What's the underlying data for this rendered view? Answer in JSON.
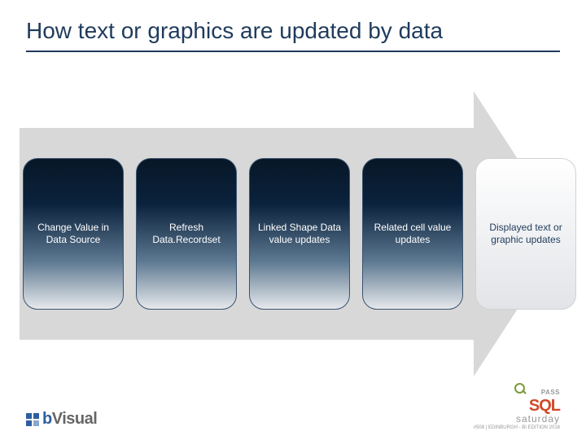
{
  "title": "How text or graphics are updated by data",
  "steps": [
    {
      "label": "Change Value in Data Source",
      "style": "dark"
    },
    {
      "label": "Refresh Data.Recordset",
      "style": "dark"
    },
    {
      "label": "Linked Shape Data value updates",
      "style": "dark"
    },
    {
      "label": "Related cell value updates",
      "style": "dark"
    },
    {
      "label": "Displayed text or graphic updates",
      "style": "light"
    }
  ],
  "footer": {
    "left_logo": {
      "prefix": "b",
      "text": "Visual"
    },
    "right_logo": {
      "pass": "PASS",
      "sql": "SQL",
      "saturday": "saturday",
      "sub": "#508 | EDINBURGH - BI EDITION 2016"
    }
  }
}
